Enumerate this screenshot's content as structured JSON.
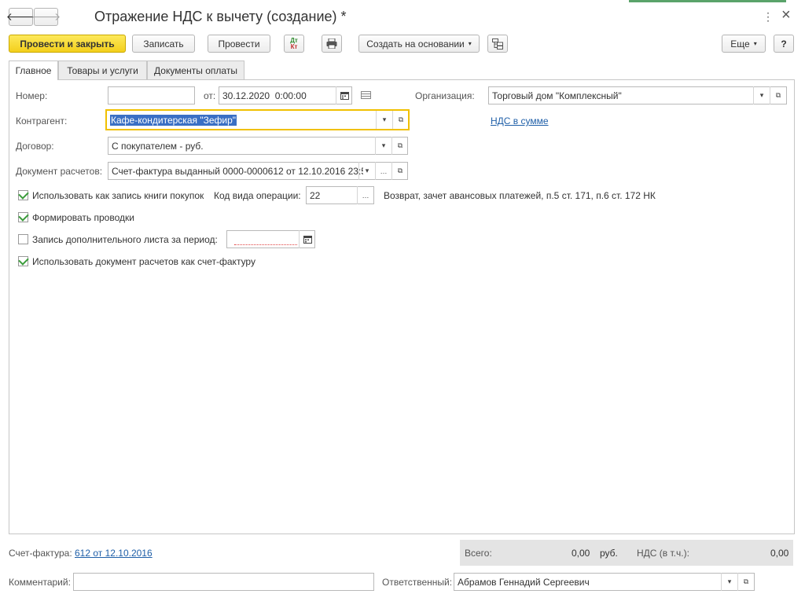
{
  "window": {
    "title": "Отражение НДС к вычету (создание) *",
    "menu_icon": "⋮",
    "close_icon": "×"
  },
  "toolbar": {
    "post_close": "Провести и закрыть",
    "save": "Записать",
    "post": "Провести",
    "dt_label": "Дт",
    "kt_label": "Кт",
    "create_based": "Создать на основании",
    "more": "Еще",
    "help": "?"
  },
  "tabs": [
    {
      "label": "Главное"
    },
    {
      "label": "Товары и услуги"
    },
    {
      "label": "Документы оплаты"
    }
  ],
  "form": {
    "number_label": "Номер:",
    "number_value": "",
    "date_label": "от:",
    "date_value": "30.12.2020  0:00:00",
    "org_label": "Организация:",
    "org_value": "Торговый дом \"Комплексный\"",
    "contractor_label": "Контрагент:",
    "contractor_value": "Кафе-кондитерская \"Зефир\"",
    "vat_link": "НДС в сумме",
    "contract_label": "Договор:",
    "contract_value": "С покупателем - руб.",
    "settle_doc_label": "Документ расчетов:",
    "settle_doc_value": "Счет-фактура выданный 0000-0000612 от 12.10.2016 23:5",
    "use_purchase_book_label": "Использовать как запись книги покупок",
    "use_purchase_book_checked": true,
    "op_code_label": "Код вида операции:",
    "op_code_value": "22",
    "op_code_desc": "Возврат, зачет авансовых платежей, п.5 ст. 171, п.6 ст. 172 НК",
    "form_entries_label": "Формировать проводки",
    "form_entries_checked": true,
    "extra_sheet_label": "Запись дополнительного листа за период:",
    "extra_sheet_checked": false,
    "extra_sheet_value": "",
    "use_settle_as_invoice_label": "Использовать документ расчетов как счет-фактуру",
    "use_settle_as_invoice_checked": true
  },
  "footer": {
    "invoice_label": "Счет-фактура:",
    "invoice_link": "612 от 12.10.2016",
    "total_label": "Всего:",
    "total_value": "0,00",
    "currency": "руб.",
    "vat_label": "НДС (в т.ч.):",
    "vat_value": "0,00",
    "comment_label": "Комментарий:",
    "comment_value": "",
    "responsible_label": "Ответственный:",
    "responsible_value": "Абрамов Геннадий Сергеевич"
  },
  "colors": {
    "primary_button": "#f3cf1c",
    "link": "#1f5fa8",
    "focus_border": "#f0c000",
    "selection": "#3a6fc4"
  }
}
